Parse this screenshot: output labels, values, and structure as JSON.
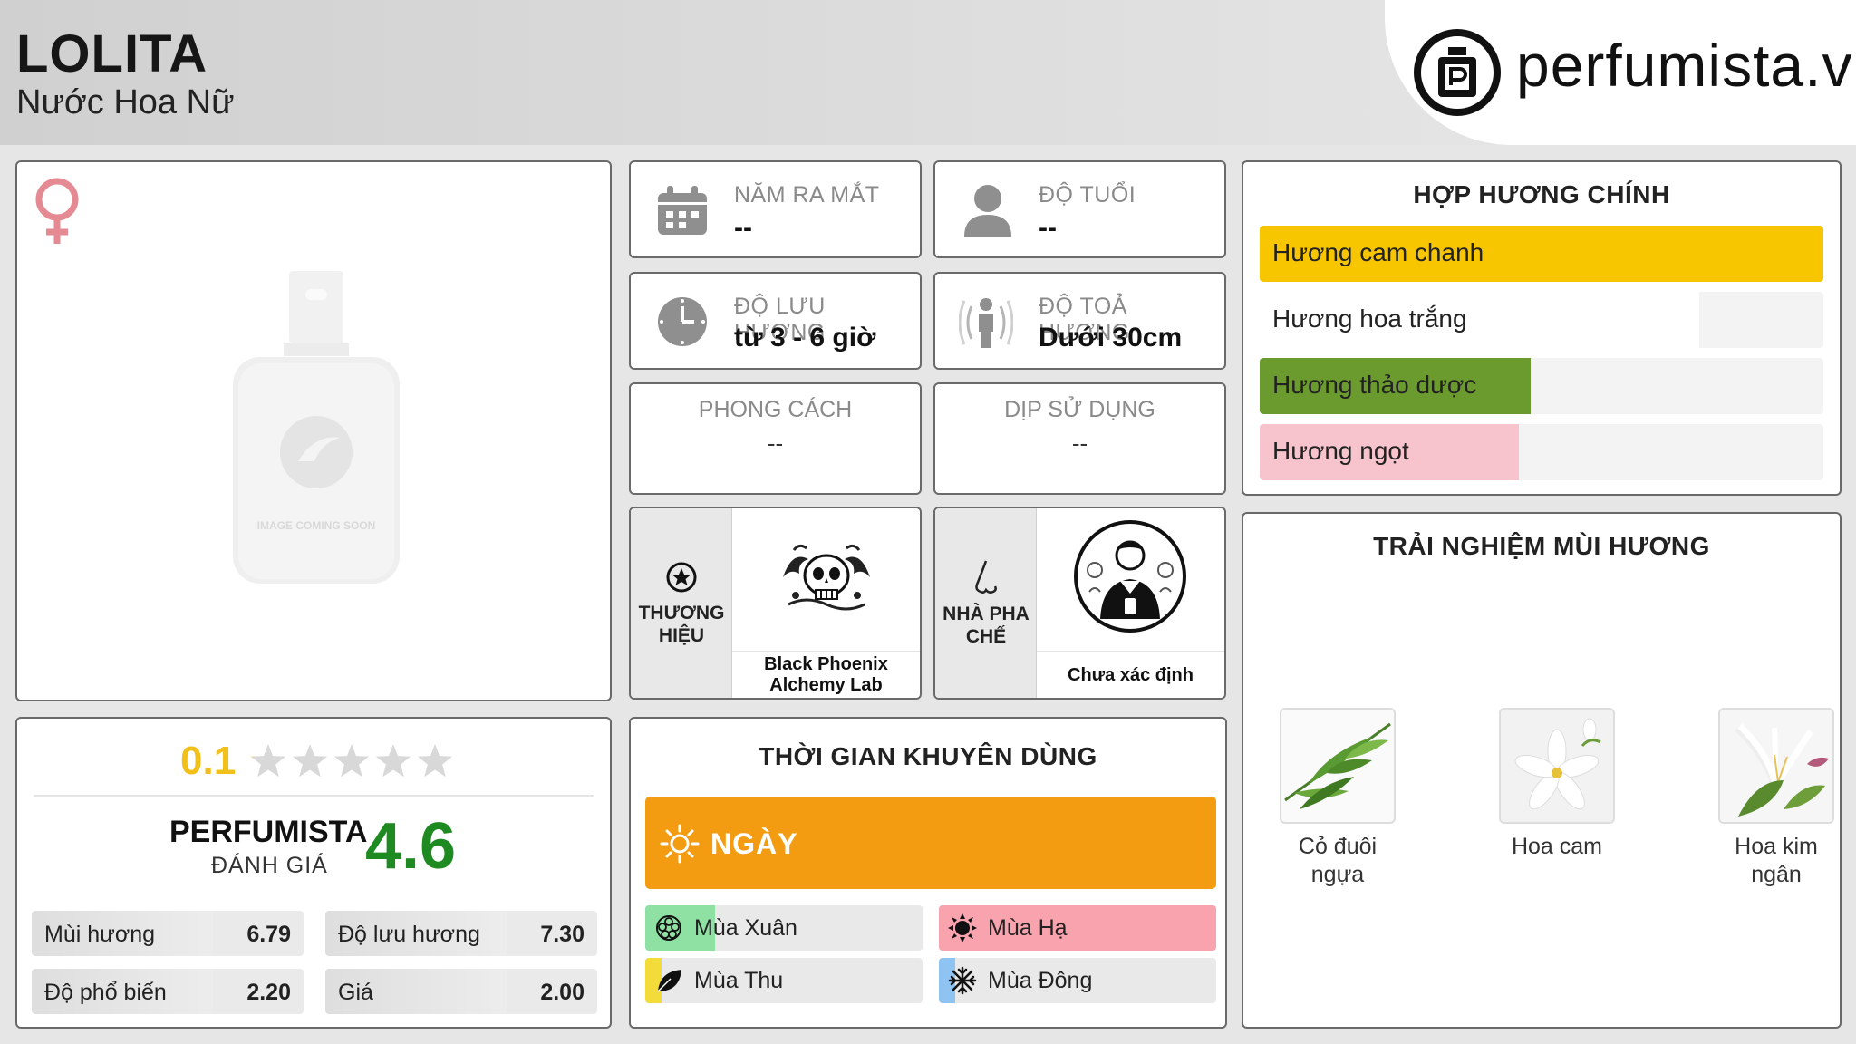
{
  "header": {
    "title": "LOLITA",
    "subtitle": "Nước Hoa Nữ",
    "logo_text": "perfumista.vn"
  },
  "image_card": {
    "placeholder_text": "IMAGE COMING SOON"
  },
  "info": {
    "release_year": {
      "label": "NĂM RA MẮT",
      "value": "--"
    },
    "age": {
      "label": "ĐỘ TUỔI",
      "value": "--"
    },
    "longevity": {
      "label": "ĐỘ LƯU HƯƠNG",
      "value": "từ 3 - 6 giờ"
    },
    "sillage": {
      "label": "ĐỘ TOẢ HƯƠNG",
      "value": "Dưới 30cm"
    },
    "style": {
      "label": "PHONG CÁCH",
      "value": "--"
    },
    "occasion": {
      "label": "DỊP SỬ DỤNG",
      "value": "--"
    },
    "brand": {
      "label_line1": "THƯƠNG",
      "label_line2": "HIỆU",
      "value": "Black Phoenix Alchemy Lab"
    },
    "perfumer": {
      "label_line1": "NHÀ PHA",
      "label_line2": "CHẾ",
      "value": "Chưa xác định"
    }
  },
  "accords": {
    "title": "HỢP HƯƠNG CHÍNH",
    "items": [
      {
        "label": "Hương cam chanh",
        "level": 1.0,
        "color": "#f7c600"
      },
      {
        "label": "Hương hoa trắng",
        "level": 0.78,
        "color": "#ffffff"
      },
      {
        "label": "Hương thảo dược",
        "level": 0.48,
        "color": "#6b9a2e"
      },
      {
        "label": "Hương ngọt",
        "level": 0.46,
        "color": "#f7c3cc"
      }
    ]
  },
  "notes": {
    "title": "TRẢI NGHIỆM MÙI HƯƠNG",
    "items": [
      {
        "line1": "Cỏ đuôi",
        "line2": "ngựa"
      },
      {
        "line1": "Hoa cam",
        "line2": ""
      },
      {
        "line1": "Hoa kim",
        "line2": "ngân"
      }
    ]
  },
  "rating": {
    "user_score": "0.1",
    "stars_filled": 0.02,
    "perfumista_label": "PERFUMISTA",
    "perfumista_sub": "ĐÁNH GIÁ",
    "perfumista_score": "4.6",
    "metrics": [
      {
        "label": "Mùi hương",
        "value": "6.79"
      },
      {
        "label": "Độ lưu hương",
        "value": "7.30"
      },
      {
        "label": "Độ phổ biến",
        "value": "2.20"
      },
      {
        "label": "Giá",
        "value": "2.00"
      }
    ]
  },
  "recommended": {
    "title": "THỜI GIAN KHUYÊN DÙNG",
    "day_label": "NGÀY",
    "day_color": "#f39c12",
    "seasons": [
      {
        "label": "Mùa Xuân",
        "level": 0.25,
        "color": "#8ee0a3"
      },
      {
        "label": "Mùa Hạ",
        "level": 1.0,
        "color": "#f8a3ad"
      },
      {
        "label": "Mùa Thu",
        "level": 0.06,
        "color": "#f3dc3a"
      },
      {
        "label": "Mùa Đông",
        "level": 0.06,
        "color": "#8fc3f2"
      }
    ]
  }
}
